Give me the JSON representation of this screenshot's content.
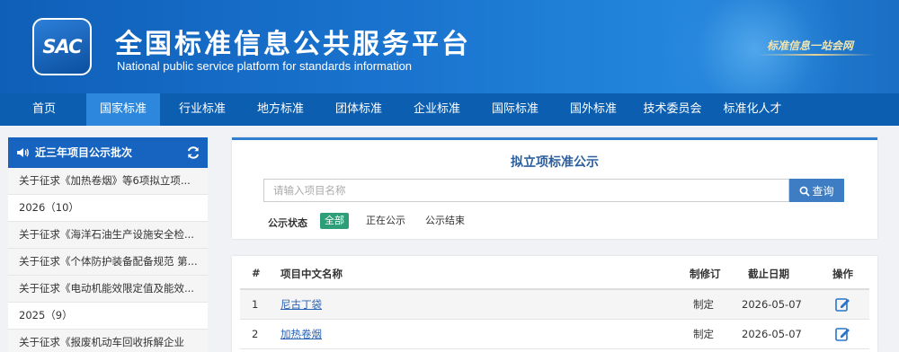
{
  "header": {
    "logo_text": "SAC",
    "title": "全国标准信息公共服务平台",
    "subtitle": "National public service platform  for standards information",
    "slogan": "标准信息一站会网"
  },
  "nav": {
    "items": [
      "首页",
      "国家标准",
      "行业标准",
      "地方标准",
      "团体标准",
      "企业标准",
      "国际标准",
      "国外标准",
      "技术委员会",
      "标准化人才"
    ],
    "active_index": 1
  },
  "sidebar": {
    "title": "近三年项目公示批次",
    "items": [
      "关于征求《加热卷烟》等6项拟立项...",
      "2026（10）",
      "关于征求《海洋石油生产设施安全检...",
      "关于征求《个体防护装备配备规范 第...",
      "关于征求《电动机能效限定值及能效...",
      "2025（9）",
      "关于征求《报废机动车回收拆解企业"
    ]
  },
  "search_panel": {
    "title": "拟立项标准公示",
    "placeholder": "请输入项目名称",
    "value": "",
    "search_button": "查询",
    "filter_label": "公示状态",
    "filters": [
      "全部",
      "正在公示",
      "公示结束"
    ],
    "active_filter": 0
  },
  "table": {
    "columns": [
      "#",
      "项目中文名称",
      "制修订",
      "截止日期",
      "操作"
    ],
    "rows": [
      {
        "index": "1",
        "name": "尼古丁袋",
        "type": "制定",
        "deadline": "2026-05-07"
      },
      {
        "index": "2",
        "name": "加热卷烟",
        "type": "制定",
        "deadline": "2026-05-07"
      }
    ]
  },
  "icons": {
    "sidebar_head": "volume-icon",
    "refresh": "refresh-icon",
    "search": "search-icon",
    "action": "edit-icon"
  },
  "colors": {
    "header_bg": "#1a74cf",
    "nav_bg": "#0c5fb0",
    "nav_active": "#2d88dd",
    "sidebar_head": "#1664bf",
    "search_button": "#3e7dc3",
    "filter_active": "#2e9e78",
    "link": "#2a63b5"
  }
}
